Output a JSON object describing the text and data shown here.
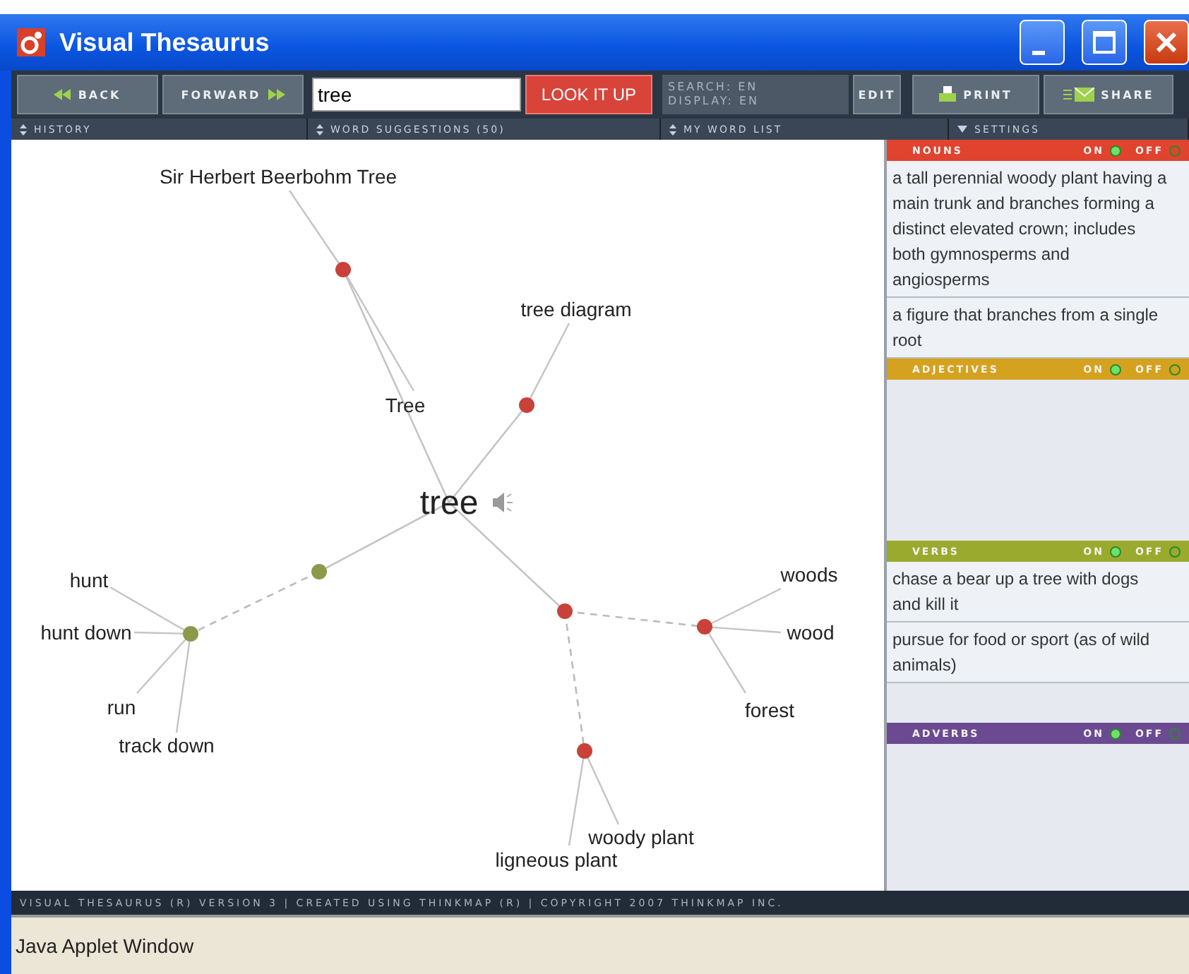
{
  "window": {
    "title": "Visual Thesaurus"
  },
  "toolbar": {
    "back": "BACK",
    "forward": "FORWARD",
    "search_value": "tree",
    "lookup": "LOOK IT UP",
    "search_lang": "SEARCH: EN",
    "display_lang": "DISPLAY: EN",
    "edit": "EDIT",
    "print": "PRINT",
    "share": "SHARE"
  },
  "subheader": [
    "HISTORY",
    "WORD SUGGESTIONS (50)",
    "MY WORD LIST",
    "SETTINGS"
  ],
  "graph": {
    "center": "tree",
    "nodes": [
      {
        "color": "#c8423a",
        "words": [
          "Sir Herbert Beerbohm Tree",
          "Tree"
        ]
      },
      {
        "color": "#c8423a",
        "words": [
          "tree diagram"
        ]
      },
      {
        "color": "#8a9a4a",
        "children": [
          {
            "color": "#8a9a4a",
            "words": [
              "hunt",
              "hunt down",
              "run",
              "track down"
            ]
          }
        ]
      },
      {
        "color": "#c8423a",
        "children": [
          {
            "color": "#c8423a",
            "words": [
              "woods",
              "wood",
              "forest"
            ]
          },
          {
            "color": "#c8423a",
            "words": [
              "woody plant",
              "ligneous plant"
            ]
          }
        ]
      }
    ]
  },
  "sections": [
    {
      "label": "NOUNS",
      "color": "#e0432e",
      "on_label": "ON",
      "off_label": "OFF",
      "on": true,
      "definitions": [
        "a tall perennial woody plant having a main trunk and branches forming a distinct elevated crown; includes both gymnosperms and angiosperms",
        "a figure that branches from a single root"
      ]
    },
    {
      "label": "ADJECTIVES",
      "color": "#d4a21e",
      "on_label": "ON",
      "off_label": "OFF",
      "on": true
    },
    {
      "label": "VERBS",
      "color": "#9aaa2e",
      "on_label": "ON",
      "off_label": "OFF",
      "on": true,
      "definitions": [
        "chase a bear up a tree with dogs and kill it",
        "pursue for food or sport (as of wild animals)"
      ]
    },
    {
      "label": "ADVERBS",
      "color": "#6b4a92",
      "on_label": "ON",
      "off_label": "OFF",
      "on": true
    }
  ],
  "footer": "VISUAL THESAURUS (R) VERSION 3 | CREATED USING THINKMAP (R) | COPYRIGHT 2007 THINKMAP INC.",
  "status": "Java Applet Window"
}
